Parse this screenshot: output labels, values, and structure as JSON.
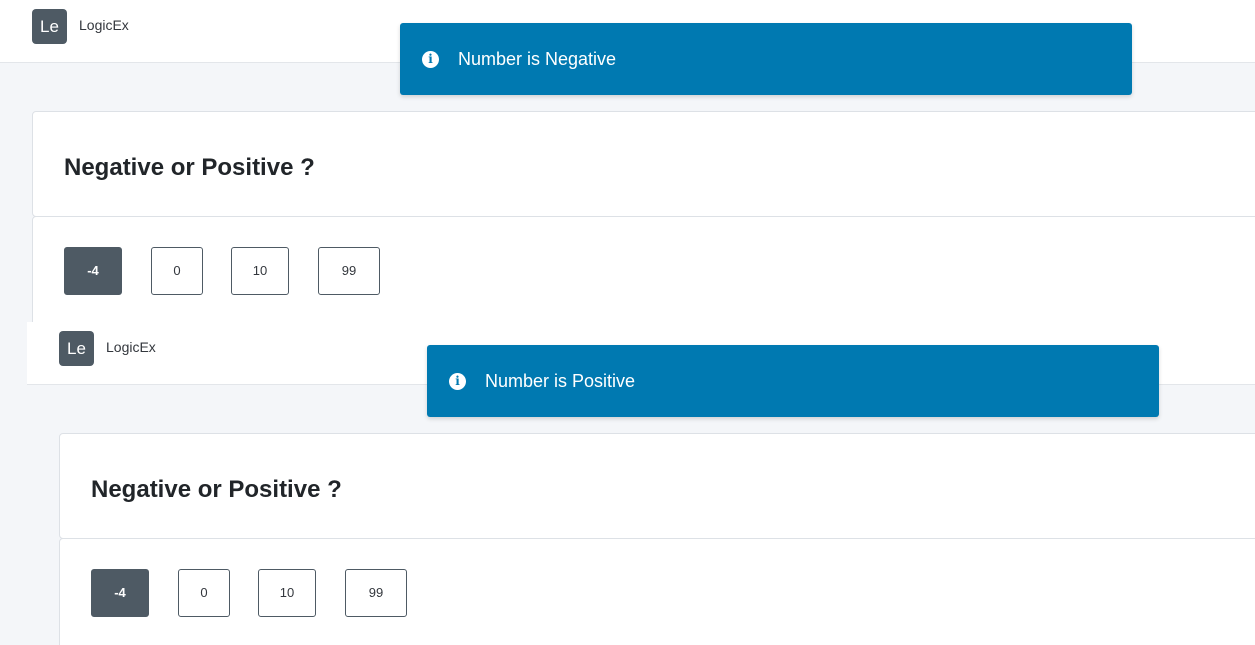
{
  "screens": [
    {
      "app": {
        "avatar_text": "Le",
        "brand": "LogicEx"
      },
      "toast": {
        "icon": "info-circle-icon",
        "message": "Number is Negative",
        "color": "#0079b1"
      },
      "card": {
        "title": "Negative or Positive ?"
      },
      "buttons": [
        {
          "label": "-4",
          "selected": true
        },
        {
          "label": "0",
          "selected": false
        },
        {
          "label": "10",
          "selected": false
        },
        {
          "label": "99",
          "selected": false
        }
      ]
    },
    {
      "app": {
        "avatar_text": "Le",
        "brand": "LogicEx"
      },
      "toast": {
        "icon": "info-circle-icon",
        "message": "Number is Positive",
        "color": "#0079b1"
      },
      "card": {
        "title": "Negative or Positive ?"
      },
      "buttons": [
        {
          "label": "-4",
          "selected": true
        },
        {
          "label": "0",
          "selected": false
        },
        {
          "label": "10",
          "selected": false
        },
        {
          "label": "99",
          "selected": false
        }
      ]
    }
  ],
  "colors": {
    "toast_bg": "#0079b1",
    "selected_button": "#4e5a64",
    "page_bg": "#f4f6f9"
  }
}
